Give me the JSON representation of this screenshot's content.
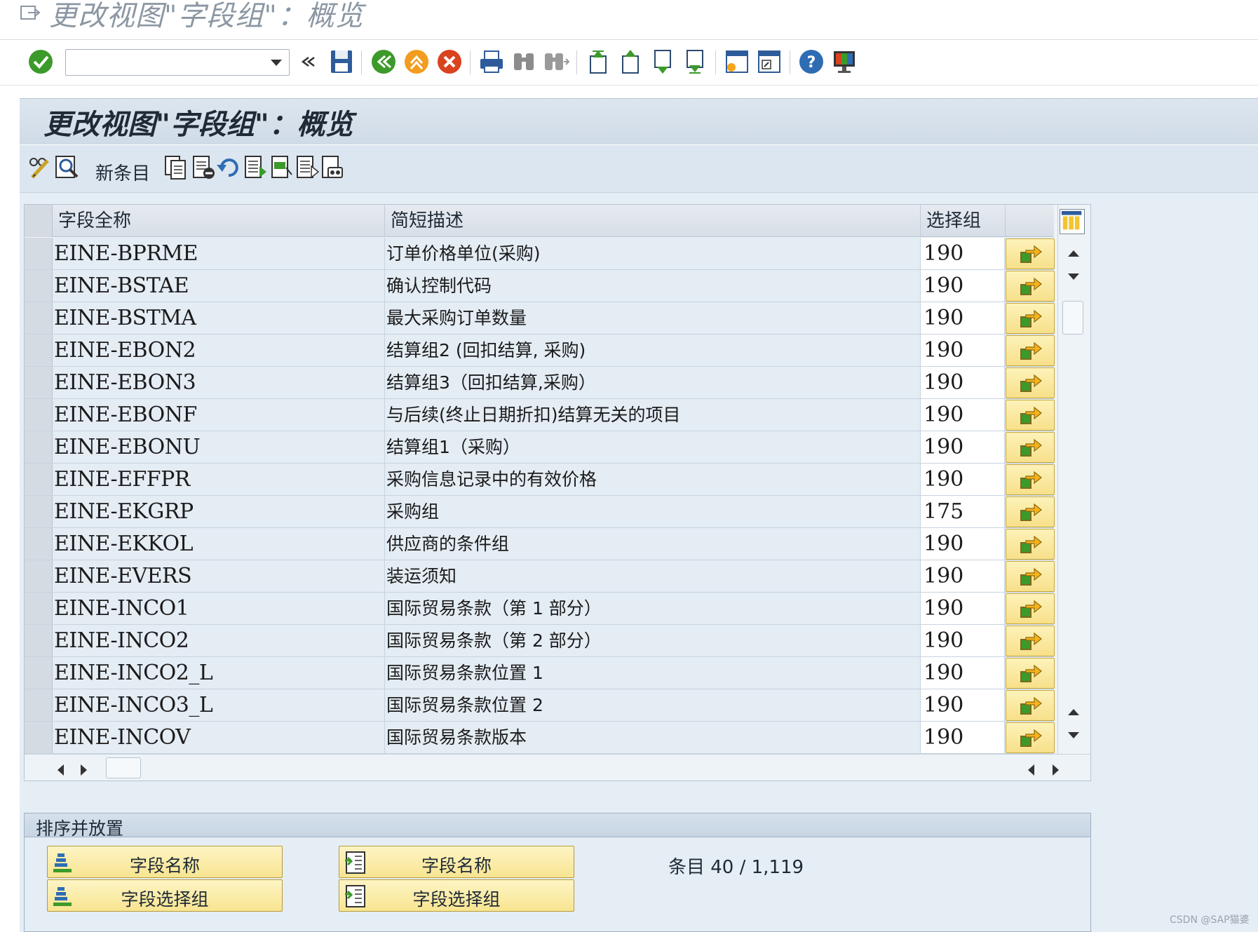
{
  "window": {
    "title": "更改视图\"字段组\"：概览"
  },
  "system_toolbar": {
    "command_field": {
      "value": "",
      "placeholder": ""
    },
    "icons": [
      "enter-icon",
      "back-icon",
      "exit-icon",
      "cancel-icon",
      "print-icon",
      "find-icon",
      "find-next-icon",
      "first-page-icon",
      "previous-page-icon",
      "next-page-icon",
      "last-page-icon",
      "create-session-icon",
      "create-shortcut-icon",
      "help-icon",
      "customize-layout-icon"
    ]
  },
  "page": {
    "title": "更改视图\"字段组\"：概览"
  },
  "app_toolbar": {
    "new_entries_label": "新条目"
  },
  "table": {
    "columns": [
      "字段全称",
      "简短描述",
      "选择组"
    ],
    "rows": [
      {
        "field": "EINE-BPRME",
        "desc": "订单价格单位(采购)",
        "group": "190"
      },
      {
        "field": "EINE-BSTAE",
        "desc": "确认控制代码",
        "group": "190"
      },
      {
        "field": "EINE-BSTMA",
        "desc": "最大采购订单数量",
        "group": "190"
      },
      {
        "field": "EINE-EBON2",
        "desc": "结算组2 (回扣结算, 采购)",
        "group": "190"
      },
      {
        "field": "EINE-EBON3",
        "desc": "结算组3（回扣结算,采购）",
        "group": "190"
      },
      {
        "field": "EINE-EBONF",
        "desc": "与后续(终止日期折扣)结算无关的项目",
        "group": "190"
      },
      {
        "field": "EINE-EBONU",
        "desc": "结算组1（采购）",
        "group": "190"
      },
      {
        "field": "EINE-EFFPR",
        "desc": "采购信息记录中的有效价格",
        "group": "190"
      },
      {
        "field": "EINE-EKGRP",
        "desc": "采购组",
        "group": "175"
      },
      {
        "field": "EINE-EKKOL",
        "desc": "供应商的条件组",
        "group": "190"
      },
      {
        "field": "EINE-EVERS",
        "desc": "装运须知",
        "group": "190"
      },
      {
        "field": "EINE-INCO1",
        "desc": "国际贸易条款（第 1 部分）",
        "group": "190"
      },
      {
        "field": "EINE-INCO2",
        "desc": "国际贸易条款（第 2 部分）",
        "group": "190"
      },
      {
        "field": "EINE-INCO2_L",
        "desc": "国际贸易条款位置 1",
        "group": "190"
      },
      {
        "field": "EINE-INCO3_L",
        "desc": "国际贸易条款位置 2",
        "group": "190"
      },
      {
        "field": "EINE-INCOV",
        "desc": "国际贸易条款版本",
        "group": "190"
      }
    ]
  },
  "sort_group": {
    "title": "排序并放置",
    "sort_buttons": [
      "字段名称",
      "字段选择组"
    ],
    "position_buttons": [
      "字段名称",
      "字段选择组"
    ],
    "entries_text": "条目 40 / 1,119"
  },
  "watermark": "CSDN @SAP猫婆",
  "colors": {
    "header_band": "#cfdbe7",
    "row_bg": "#e4ecf4",
    "yellow_button": "#f8e591",
    "accent_green": "#3c9a2a"
  }
}
